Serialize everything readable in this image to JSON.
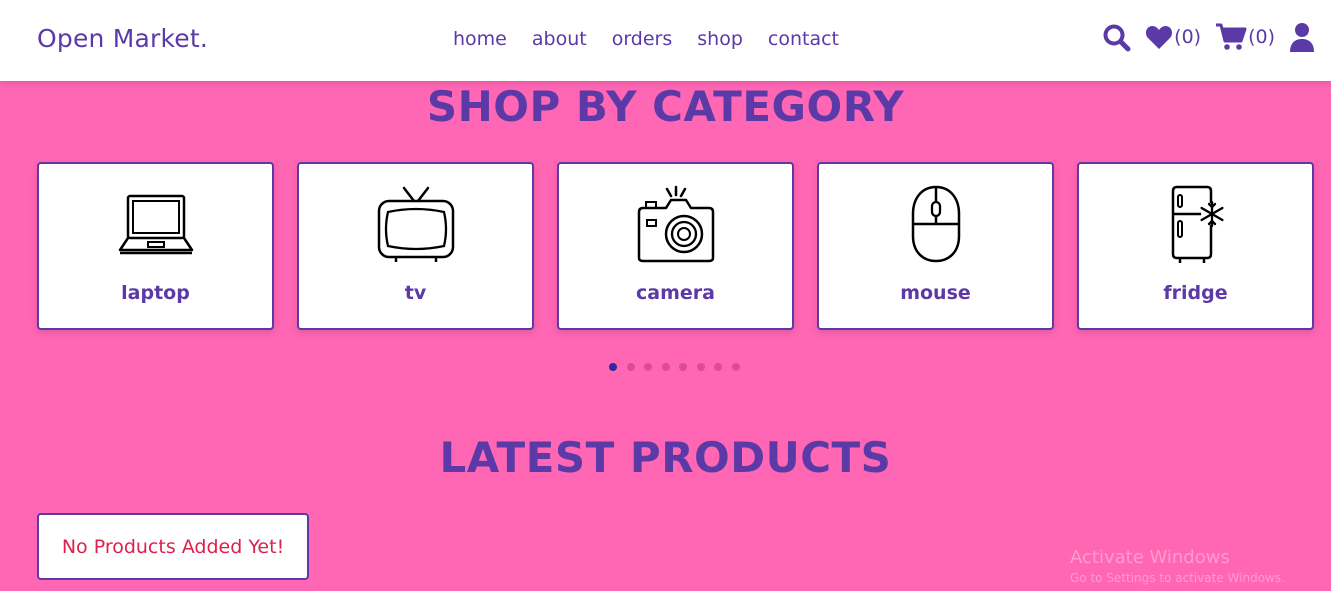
{
  "header": {
    "logo": "Open Market.",
    "nav": [
      "home",
      "about",
      "orders",
      "shop",
      "contact"
    ],
    "wishlist_count": "(0)",
    "cart_count": "(0)",
    "icons": [
      "search-icon",
      "heart-icon",
      "cart-icon",
      "user-icon"
    ]
  },
  "category_section": {
    "title": "SHOP BY CATEGORY",
    "categories": [
      {
        "label": "laptop",
        "icon": "laptop-icon"
      },
      {
        "label": "tv",
        "icon": "tv-icon"
      },
      {
        "label": "camera",
        "icon": "camera-icon"
      },
      {
        "label": "mouse",
        "icon": "mouse-icon"
      },
      {
        "label": "fridge",
        "icon": "fridge-icon"
      }
    ],
    "carousel_pages": 8,
    "carousel_active": 1
  },
  "products_section": {
    "title": "LATEST PRODUCTS",
    "empty_message": "No Products Added Yet!"
  },
  "watermark": {
    "line1": "Activate Windows",
    "line2": "Go to Settings to activate Windows."
  },
  "colors": {
    "background": "#ff66b4",
    "accent": "#5b3aa8",
    "error": "#dc1f4c"
  }
}
